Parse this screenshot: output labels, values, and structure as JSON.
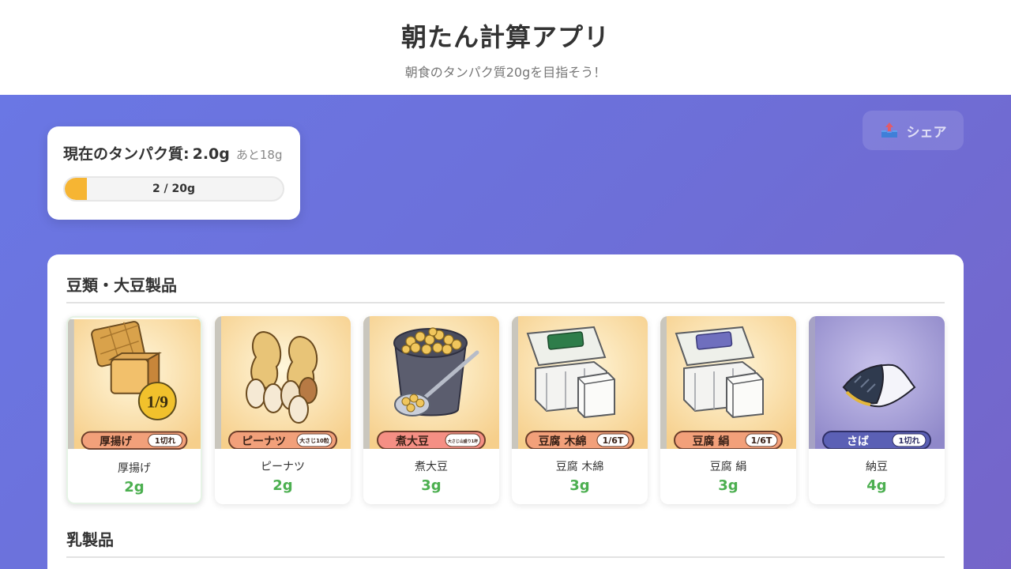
{
  "header": {
    "title": "朝たん計算アプリ",
    "subtitle": "朝食のタンパク質20gを目指そう！"
  },
  "status": {
    "label": "現在のタンパク質:",
    "value": "2.0",
    "unit": "g",
    "remaining": "あと18g",
    "progress_text": "2 / 20g",
    "progress_fraction": 0.1,
    "accent_color": "#f6b533"
  },
  "share": {
    "label": "シェア",
    "icon": "share-tray-icon"
  },
  "sections": [
    {
      "title": "豆類・大豆製品",
      "items": [
        {
          "name": "厚揚げ",
          "protein": "2g",
          "card_label": "厚揚げ",
          "card_tag": "1切れ"
        },
        {
          "name": "ピーナツ",
          "protein": "2g",
          "card_label": "ピーナツ",
          "card_tag": "大さじ10粒"
        },
        {
          "name": "煮大豆",
          "protein": "3g",
          "card_label": "煮大豆",
          "card_tag": "大さじ山盛り1杯"
        },
        {
          "name": "豆腐 木綿",
          "protein": "3g",
          "card_label": "豆腐 木綿",
          "card_tag": "1/6T"
        },
        {
          "name": "豆腐 絹",
          "protein": "3g",
          "card_label": "豆腐 絹",
          "card_tag": "1/6T"
        },
        {
          "name": "納豆",
          "protein": "4g",
          "card_label": "さば",
          "card_tag": "1切れ"
        }
      ]
    },
    {
      "title": "乳製品"
    }
  ],
  "colors": {
    "protein_green": "#4caf50",
    "gradient_start": "#6a77e4",
    "gradient_end": "#7565c9"
  }
}
